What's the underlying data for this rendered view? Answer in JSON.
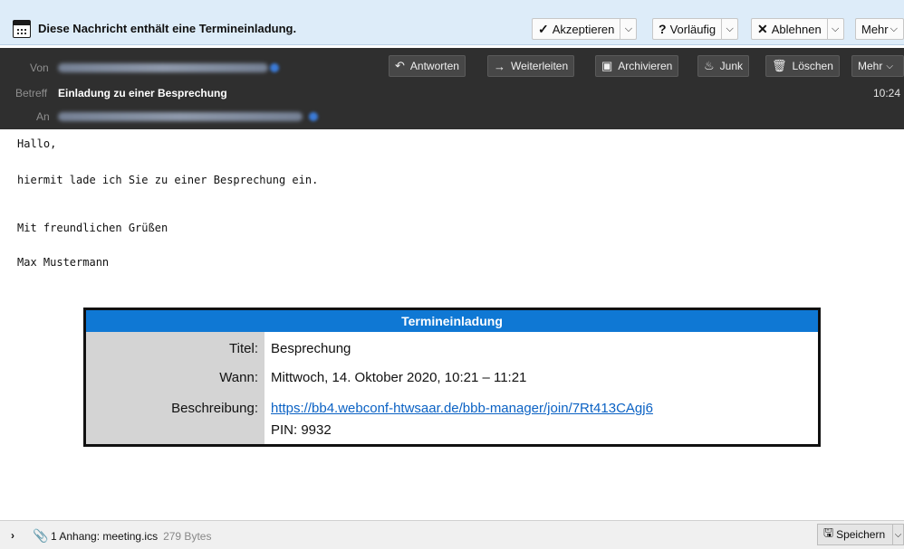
{
  "invitation_bar": {
    "text": "Diese Nachricht enthält eine Termineinladung.",
    "accept_label": "Akzeptieren",
    "tentative_label": "Vorläufig",
    "decline_label": "Ablehnen",
    "more_label": "Mehr"
  },
  "header": {
    "from_label": "Von",
    "subject_label": "Betreff",
    "to_label": "An",
    "subject": "Einladung zu einer Besprechung",
    "time": "10:24",
    "toolbar": {
      "reply": "Antworten",
      "forward": "Weiterleiten",
      "archive": "Archivieren",
      "junk": "Junk",
      "delete": "Löschen",
      "more": "Mehr"
    }
  },
  "body": {
    "greeting": "Hallo,",
    "line1": "hiermit lade ich Sie zu einer Besprechung ein.",
    "closing": "Mit freundlichen Grüßen",
    "signature": "Max Mustermann"
  },
  "card": {
    "title": "Termineinladung",
    "title_label": "Titel:",
    "title_value": "Besprechung",
    "when_label": "Wann:",
    "when_value": "Mittwoch, 14. Oktober 2020, 10:21 – 11:21",
    "desc_label": "Beschreibung:",
    "desc_link": "https://bb4.webconf-htwsaar.de/bbb-manager/join/7Rt413CAgj6",
    "desc_pin": "PIN: 9932"
  },
  "attachment": {
    "summary": "1 Anhang: meeting.ics",
    "size": "279 Bytes",
    "save_label": "Speichern"
  },
  "colors": {
    "invite_bar_bg": "#ddecf9",
    "header_bg": "#2f2f2f",
    "card_title_bg": "#0f78d4",
    "link": "#0b62c4"
  }
}
